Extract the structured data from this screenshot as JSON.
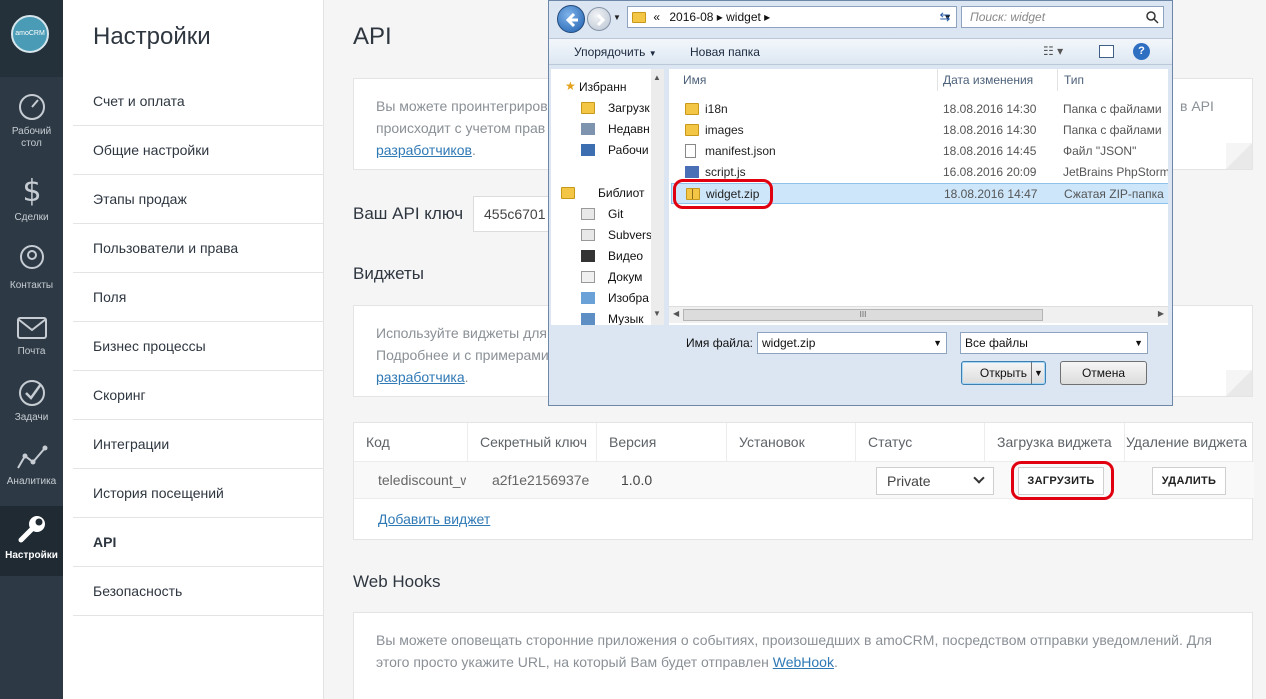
{
  "nav": {
    "logo": "amoCRM",
    "items": [
      {
        "label": "Рабочий\nстол",
        "icon": "dashboard-icon"
      },
      {
        "label": "Сделки",
        "icon": "dollar-icon"
      },
      {
        "label": "Контакты",
        "icon": "contact-icon"
      },
      {
        "label": "Почта",
        "icon": "mail-icon"
      },
      {
        "label": "Задачи",
        "icon": "check-icon"
      },
      {
        "label": "Аналитика",
        "icon": "analytics-icon"
      },
      {
        "label": "Настройки",
        "icon": "settings-icon"
      }
    ]
  },
  "settings": {
    "title": "Настройки",
    "items": [
      "Счет и оплата",
      "Общие настройки",
      "Этапы продаж",
      "Пользователи и права",
      "Поля",
      "Бизнес процессы",
      "Скоринг",
      "Интеграции",
      "История посещений",
      "API",
      "Безопасность"
    ]
  },
  "main": {
    "title": "API",
    "intro_line1": "Вы можете проинтегриров",
    "intro_line1_tail": "в API",
    "intro_line2": "происходит с учетом прав",
    "intro_link": "разработчиков",
    "apikey_label": "Ваш API ключ",
    "apikey_value": "455c6701",
    "widgets_title": "Виджеты",
    "widgets_line1": "Используйте виджеты для",
    "widgets_line2": "Подробнее и с примерами",
    "widgets_link": "разработчика",
    "table": {
      "headers": [
        "Код",
        "Секретный ключ",
        "Версия",
        "Установок",
        "Статус",
        "Загрузка виджета",
        "Удаление виджета"
      ],
      "row": {
        "code": "telediscount_w",
        "secret": "a2f1e2156937e",
        "version": "1.0.0",
        "installs": "",
        "status": "Private"
      },
      "upload_button": "ЗАГРУЗИТЬ",
      "delete_button": "УДАЛИТЬ",
      "add_link": "Добавить виджет"
    },
    "webhooks_title": "Web Hooks",
    "webhooks_line1": "Вы можете оповещать сторонние приложения о событиях, произошедших в amoCRM, посредством отправки уведомлений. Для",
    "webhooks_line2": "этого просто укажите URL, на который Вам будет отправлен",
    "webhooks_link": "WebHook"
  },
  "dialog": {
    "path": [
      "«",
      "2016-08",
      "widget"
    ],
    "search_placeholder": "Поиск: widget",
    "toolbar": {
      "organize": "Упорядочить",
      "new_folder": "Новая папка"
    },
    "tree": [
      "Избранн",
      "Загрузк",
      "Недавн",
      "Рабочи",
      "Библиот",
      "Git",
      "Subvers",
      "Видео",
      "Докум",
      "Изобра",
      "Музык"
    ],
    "columns": [
      "Имя",
      "Дата изменения",
      "Тип"
    ],
    "files": [
      {
        "name": "i18n",
        "date": "18.08.2016 14:30",
        "type": "Папка с файлами"
      },
      {
        "name": "images",
        "date": "18.08.2016 14:30",
        "type": "Папка с файлами"
      },
      {
        "name": "manifest.json",
        "date": "18.08.2016 14:45",
        "type": "Файл \"JSON\""
      },
      {
        "name": "script.js",
        "date": "16.08.2016 20:09",
        "type": "JetBrains PhpStorm"
      },
      {
        "name": "widget.zip",
        "date": "18.08.2016 14:47",
        "type": "Сжатая ZIP-папка"
      }
    ],
    "filename_label": "Имя файла:",
    "filename_value": "widget.zip",
    "filter_value": "Все файлы",
    "open_button": "Открыть",
    "cancel_button": "Отмена",
    "scroll_thumb": "III"
  }
}
